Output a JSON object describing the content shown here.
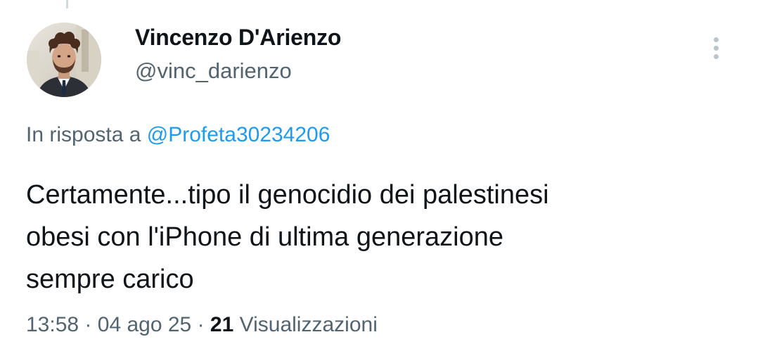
{
  "tweet": {
    "author": {
      "display_name": "Vincenzo D'Arienzo",
      "handle": "@vinc_darienzo"
    },
    "reply_prefix": "In risposta a",
    "reply_to": "@Profeta30234206",
    "text": "Certamente...tipo il genocidio dei palestinesi\nobesi con l'iPhone di ultima generazione\nsempre carico",
    "time": "13:58",
    "separator": "·",
    "date": "04 ago 25",
    "views_count": "21",
    "views_label": "Visualizzazioni"
  },
  "icons": {
    "more": "more-vertical-icon"
  },
  "colors": {
    "primary_text": "#0f1419",
    "secondary_text": "#536471",
    "link": "#1d9bf0",
    "background": "#ffffff"
  }
}
